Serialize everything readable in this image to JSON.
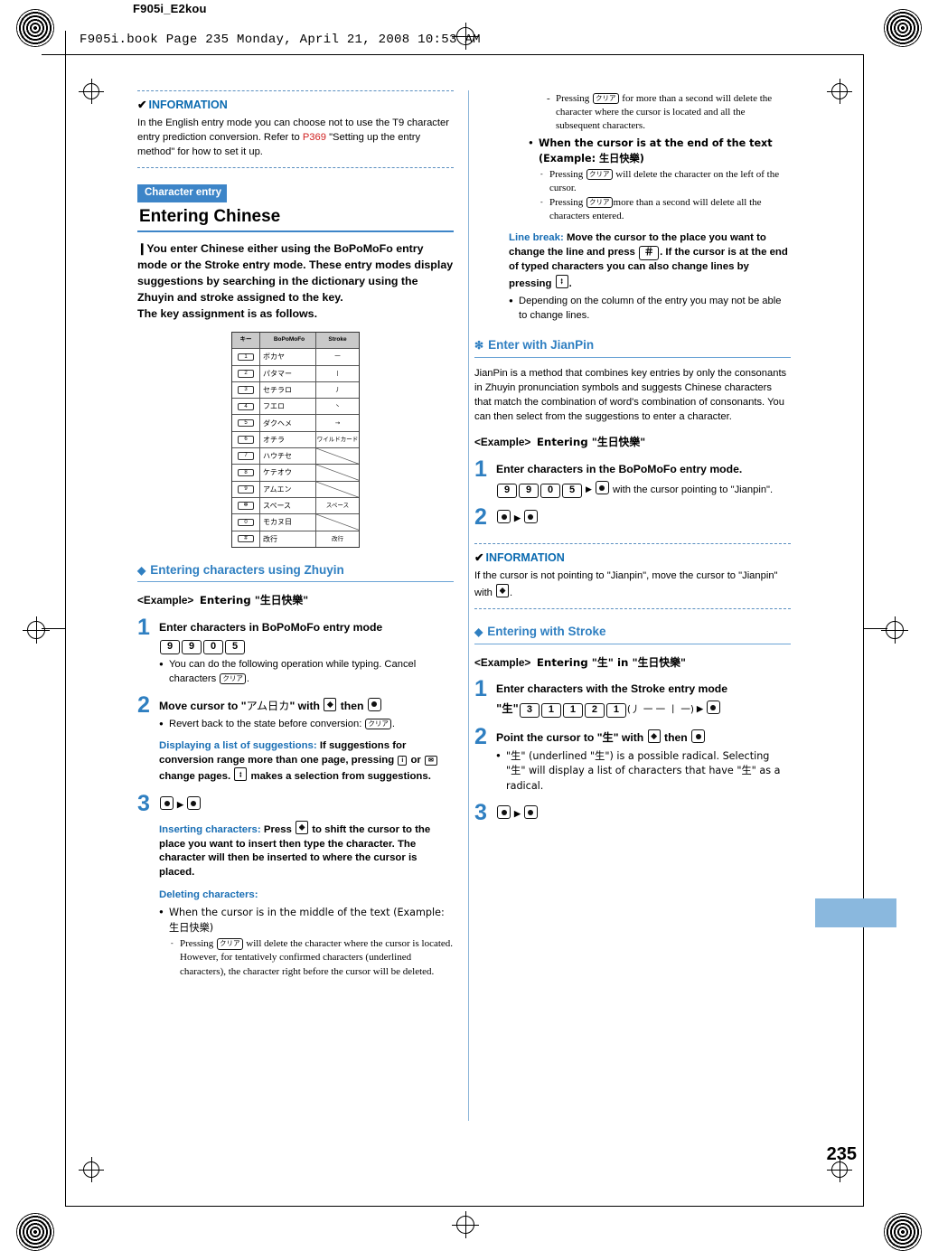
{
  "header": {
    "file_id": "F905i_E2kou",
    "book_line": "F905i.book  Page 235  Monday, April 21, 2008  10:53 AM"
  },
  "page_number": "235",
  "left": {
    "info1": {
      "check": "✔",
      "title": "INFORMATION",
      "body_1": "In the English entry mode you can choose not to use the T9 character entry prediction conversion. Refer to ",
      "ref": "P369",
      "body_2": " \"Setting up the entry method\" for how to set it up."
    },
    "section_tag": "Character entry",
    "chapter_title": "Entering Chinese",
    "lead": "❙You enter Chinese either using the BoPoMoFo entry mode or the Stroke entry mode. These entry modes display suggestions by searching in the dictionary using the Zhuyin and stroke assigned to the key.\nThe key assignment is as follows.",
    "keytable": {
      "headers": [
        "キー",
        "BoPoMoFo",
        "Stroke"
      ],
      "rows": [
        {
          "key": "1",
          "sub": ".@-",
          "bopomofo": "ボカヤ",
          "stroke": "一"
        },
        {
          "key": "2",
          "sub": "ABC",
          "bopomofo": "パタマー",
          "stroke": "丨"
        },
        {
          "key": "3",
          "sub": "DEF",
          "bopomofo": "セチラロ",
          "stroke": "丿"
        },
        {
          "key": "4",
          "sub": "GHI",
          "bopomofo": "フエロ",
          "stroke": "丶"
        },
        {
          "key": "5",
          "sub": "JKL",
          "bopomofo": "ダクヘメ",
          "stroke": "→"
        },
        {
          "key": "6",
          "sub": "MNO",
          "bopomofo": "オチラ",
          "stroke": "ワイルドカード"
        },
        {
          "key": "7",
          "sub": "PQRS",
          "bopomofo": "ハウチセ",
          "stroke": ""
        },
        {
          "key": "8",
          "sub": "TUV",
          "bopomofo": "ケテオウ",
          "stroke": ""
        },
        {
          "key": "9",
          "sub": "WXYZ",
          "bopomofo": "アムエン",
          "stroke": ""
        },
        {
          "key": "✻",
          "sub": "",
          "bopomofo": "スペース",
          "stroke": "スペース"
        },
        {
          "key": "0",
          "sub": "＋",
          "bopomofo": "モカヌ日",
          "stroke": ""
        },
        {
          "key": "＃",
          "sub": "↵",
          "bopomofo": "改行",
          "stroke": "改行"
        }
      ]
    },
    "h_zhuyin": "Entering characters using Zhuyin",
    "example1": {
      "lt": "<Example>",
      "text": "Entering \"生日快樂\""
    },
    "step1": {
      "num": "1",
      "title": "Enter characters in BoPoMoFo entry mode",
      "keys": [
        "9",
        "9",
        "0",
        "5"
      ],
      "bullet": "You can do the following operation while typing. Cancel characters ",
      "bullet_key": "クリア",
      "bullet_end": "."
    },
    "step2": {
      "num": "2",
      "title_a": "Move cursor to \"",
      "title_cjk": "アム日カ",
      "title_b": "\" with ",
      "title_c": " then ",
      "bullet": "Revert back to the state before conversion: ",
      "bullet_key": "クリア",
      "bullet_end": ".",
      "note_label": "Displaying a list of suggestions:",
      "note_text_1": " If suggestions for conversion range more than one page, pressing ",
      "note_key1": "i",
      "note_text_2": " or ",
      "note_key2": "✉",
      "note_text_3": " change pages. ",
      "note_text_4": " makes a selection from suggestions."
    },
    "step3": {
      "num": "3",
      "note_label_1": "Inserting characters:",
      "note_text_1": " Press ",
      "note_text_2": " to shift the cursor to the place you want to insert then type the character. The character will then be inserted to where the cursor is placed.",
      "note_label_2": "Deleting characters:",
      "b1": "When the cursor is in the middle of the text (Example: 生日快樂)",
      "d1_a": "Pressing ",
      "d1_key": "クリア",
      "d1_b": " will delete the character where the cursor is located.",
      "d1_c": "However, for tentatively confirmed characters (underlined characters), the character right before the cursor will be deleted."
    }
  },
  "right": {
    "top_dashes": [
      {
        "a": "Pressing ",
        "key": "クリア",
        "b": " for more than a second will delete the character where the cursor is located and all the subsequent characters."
      }
    ],
    "b_cursor_end": "When the cursor is at the end of the text (Example: 生日快樂)",
    "d2_a": "Pressing ",
    "d2_key": "クリア",
    "d2_b": " will delete the character on the left of the cursor.",
    "d3_a": "Pressing ",
    "d3_key": "クリア",
    "d3_b": "more than a second will delete all the characters entered.",
    "linebreak_label": "Line break:",
    "linebreak_1": " Move the cursor to the place you want to change the line and press ",
    "linebreak_key": "＃",
    "linebreak_2": ". If the cursor is at the end of typed characters you can also change lines by pressing ",
    "linebreak_3": ".",
    "linebreak_bullet": "Depending on the column of the entry you may not be able to change lines.",
    "h_jianpin": "Enter with JianPin",
    "jianpin_body": "JianPin is a method that combines key entries by only the consonants in Zhuyin pronunciation symbols and suggests Chinese characters that match the combination of word's combination of consonants. You can then select from the suggestions to enter a character.",
    "example2": {
      "lt": "<Example>",
      "text": "Entering \"生日快樂\""
    },
    "r_step1": {
      "num": "1",
      "title": "Enter characters in the BoPoMoFo entry mode.",
      "keys": [
        "9",
        "9",
        "0",
        "5"
      ],
      "after": " with the cursor pointing to \"Jianpin\"."
    },
    "r_step2": {
      "num": "2"
    },
    "info2": {
      "check": "✔",
      "title": "INFORMATION",
      "body_1": "If the cursor is not pointing to \"Jianpin\", move the cursor to \"Jianpin\" with ",
      "body_2": "."
    },
    "h_stroke": "Entering with Stroke",
    "example3": {
      "lt": "<Example>",
      "text": "Entering \"生\" in \"生日快樂\""
    },
    "s_step1": {
      "num": "1",
      "title": "Enter characters with the Stroke entry mode",
      "quote": "\"生\"",
      "keys": [
        "3",
        "1",
        "1",
        "2",
        "1"
      ],
      "paren": "(丿 一 一 丨 一)"
    },
    "s_step2": {
      "num": "2",
      "title_a": "Point the cursor to \"",
      "title_cjk": "生",
      "title_b": "\" with ",
      "title_c": " then ",
      "bullet_1": "\"生\" (underlined \"生\") is a possible radical. Selecting \"生\" will display a list of characters that have \"生\" as a radical."
    },
    "s_step3": {
      "num": "3"
    }
  }
}
